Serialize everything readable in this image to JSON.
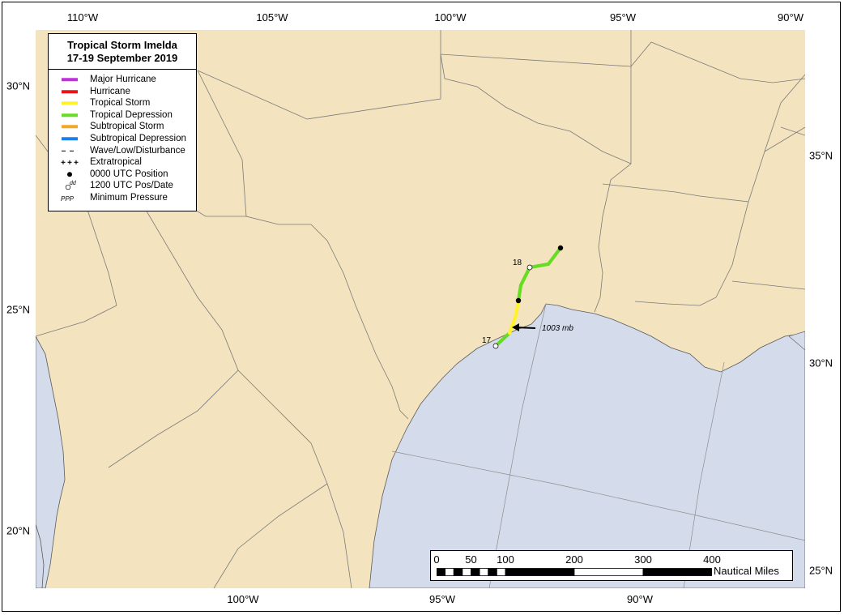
{
  "map": {
    "title_line1": "Tropical Storm Imelda",
    "title_line2": "17-19 September 2019",
    "land_color": "#f3e4bf",
    "water_color": "#d4dcec",
    "top_ticks": [
      "110°W",
      "105°W",
      "100°W",
      "95°W",
      "90°W"
    ],
    "bottom_ticks": [
      "100°W",
      "95°W",
      "90°W"
    ],
    "left_ticks": [
      "30°N",
      "25°N",
      "20°N"
    ],
    "right_ticks": [
      "35°N",
      "30°N",
      "25°N"
    ]
  },
  "legend": {
    "items": [
      {
        "label": "Major Hurricane",
        "symbol": "line",
        "color": "#c22ee0"
      },
      {
        "label": "Hurricane",
        "symbol": "line",
        "color": "#e8141a"
      },
      {
        "label": "Tropical Storm",
        "symbol": "line",
        "color": "#fff22b"
      },
      {
        "label": "Tropical Depression",
        "symbol": "line",
        "color": "#66dd22"
      },
      {
        "label": "Subtropical Storm",
        "symbol": "line",
        "color": "#f5a623"
      },
      {
        "label": "Subtropical Depression",
        "symbol": "line",
        "color": "#1c7ee8"
      },
      {
        "label": "Wave/Low/Disturbance",
        "symbol": "dash",
        "color": "#000000"
      },
      {
        "label": "Extratropical",
        "symbol": "plus",
        "color": "#000000"
      },
      {
        "label": "0000 UTC Position",
        "symbol": "dot-filled",
        "color": "#000000"
      },
      {
        "label": "1200 UTC Pos/Date",
        "symbol": "dot-open",
        "color": "#000000",
        "superscript": "dd"
      },
      {
        "label": "Minimum Pressure",
        "symbol": "pressure",
        "color": "#000000",
        "symbol_text": "PPP"
      }
    ]
  },
  "track": {
    "date_labels": [
      "17",
      "18"
    ],
    "pressure_label": "1003 mb",
    "segments": [
      {
        "stage": "Tropical Depression",
        "color": "#66dd22"
      },
      {
        "stage": "Tropical Storm",
        "color": "#fff22b"
      },
      {
        "stage": "Tropical Depression",
        "color": "#66dd22"
      }
    ]
  },
  "scale_bar": {
    "labels": [
      "0",
      "50",
      "100",
      "200",
      "300",
      "400"
    ],
    "values": [
      0,
      50,
      100,
      200,
      300,
      400
    ],
    "units": "Nautical Miles"
  }
}
